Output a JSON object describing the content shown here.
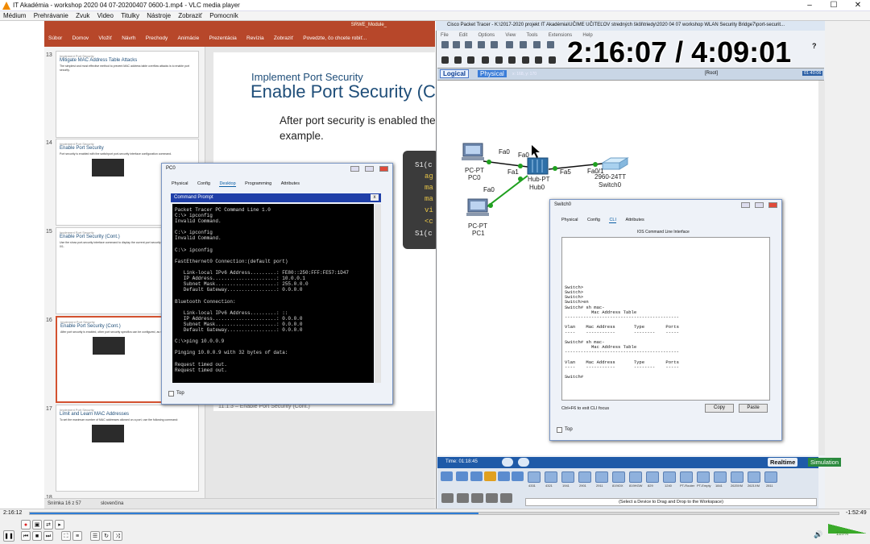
{
  "vlc": {
    "title": "IT Akadémia - workshop 2020 04 07-20200407 0600-1.mp4 - VLC media player",
    "menu": [
      "Médium",
      "Prehrávanie",
      "Zvuk",
      "Video",
      "Titulky",
      "Nástroje",
      "Zobraziť",
      "Pomocník"
    ],
    "elapsed": "2:16:12",
    "remaining": "-1:52:49",
    "volume": "120%",
    "progress_fraction": 0.555
  },
  "ppt": {
    "titlebar": "SRWE_Module_",
    "ribbon": [
      "Súbor",
      "Domov",
      "Vložiť",
      "Návrh",
      "Prechody",
      "Animácie",
      "Prezentácia",
      "Revízia",
      "Zobraziť",
      "Povedzte, čo chcete robiť..."
    ],
    "thumbs": [
      {
        "num": "13",
        "small": "Implement Port Security",
        "heading": "Mitigate MAC Address Table Attacks",
        "body": "The simplest and most effective method to prevent MAC address table overflow attacks is to enable port security."
      },
      {
        "num": "14",
        "small": "Implement Port Security",
        "heading": "Enable Port Security",
        "body": "Port security is enabled with the switchport port-security interface configuration command."
      },
      {
        "num": "15",
        "small": "Implement Port Security",
        "heading": "Enable Port Security (Cont.)",
        "body": "Use the show port-security interface command to display the current port security settings for FastEthernet 0/1."
      },
      {
        "num": "16",
        "small": "Implement Port Security",
        "heading": "Enable Port Security (Cont.)",
        "body": "After port security is enabled, other port security specifics can be configured, as shown in the example."
      },
      {
        "num": "17",
        "small": "Implement Port Security",
        "heading": "Limit and Learn MAC Addresses",
        "body": "To set the maximum number of MAC addresses allowed on a port, use the following command:"
      }
    ],
    "last_thumb_num": "18",
    "slide_subtitle": "Implement Port Security",
    "slide_title": "Enable Port Security (C",
    "slide_body": "After port security is enabled the example.",
    "code_lines": [
      "S1(c",
      "ag",
      "ma",
      "ma",
      "vi",
      "<c",
      "S1(c"
    ],
    "caption": "11.1.3 – Enable Port Security (Cont.)",
    "status": "Snímka 16 z 57",
    "status_lang": "slovenčina"
  },
  "pc0": {
    "title": "PC0",
    "tabs": [
      "Physical",
      "Config",
      "Desktop",
      "Programming",
      "Attributes"
    ],
    "cmd_title": "Command Prompt",
    "console": "Packet Tracer PC Command Line 1.0\nC:\\> ipconfig\nInvalid Command.\n\nC:\\> ipconfig\nInvalid Command.\n\nC:\\> ipconfig\n\nFastEthernet0 Connection:(default port)\n\n   Link-local IPv6 Address.........: FE80::250:FFF:FE57:1D47\n   IP Address......................: 10.0.0.1\n   Subnet Mask.....................: 255.0.0.0\n   Default Gateway.................: 0.0.0.0\n\nBluetooth Connection:\n\n   Link-local IPv6 Address.........: ::\n   IP Address......................: 0.0.0.0\n   Subnet Mask.....................: 0.0.0.0\n   Default Gateway.................: 0.0.0.0\n\nC:\\>ping 10.0.0.9\n\nPinging 10.0.0.9 with 32 bytes of data:\n\nRequest timed out.\nRequest timed out.",
    "top_label": "Top"
  },
  "pt": {
    "title": "Cisco Packet Tracer - K:\\2017-2020 projekt IT Akadémia\\UČIME UČITEĽOV stredných škôl\\triedy\\2020 04 07 workshop WLAN Security Bridge7\\port-securit...",
    "menu": [
      "File",
      "Edit",
      "Options",
      "View",
      "Tools",
      "Extensions",
      "Help"
    ],
    "logical": "Logical",
    "physical": "Physical",
    "coords": "x: 168, y: 170",
    "root": "[Root]",
    "clock": "01:40:06",
    "overlay_timer": "2:16:07 / 4:09:01",
    "devices": [
      {
        "name": "PC-PT",
        "sub": "PC0"
      },
      {
        "name": "PC-PT",
        "sub": "PC1"
      },
      {
        "name": "Hub-PT",
        "sub": "Hub0"
      },
      {
        "name": "2960-24TT",
        "sub": "Switch0"
      }
    ],
    "ports": {
      "pc0": "Fa0",
      "hub_top": "Fa0",
      "hub_left": "Fa1",
      "pc1": "Fa0",
      "hub_right": "Fa5",
      "sw": "Fa0/1"
    },
    "time": "Time: 01:18:45",
    "realtime": "Realtime",
    "simulation": "Simulation",
    "device_models": [
      "4331",
      "4321",
      "1941",
      "2901",
      "2911",
      "819IOX",
      "819HGW",
      "829",
      "1240",
      "PT-Router",
      "PT-Empty",
      "1841",
      "2620XM",
      "2621XM",
      "2811"
    ],
    "drag_hint": "(Select a Device to Drag and Drop to the Workspace)"
  },
  "switch": {
    "title": "Switch0",
    "tabs": [
      "Physical",
      "Config",
      "CLI",
      "Attributes"
    ],
    "heading": "IOS Command Line Interface",
    "cli": "\n\n\n\n\n\n\n\n\nSwitch>\nSwitch>\nSwitch>\nSwitch>en\nSwitch# sh mac-\n          Mac Address Table\n-------------------------------------------\n\nVlan    Mac Address       Type        Ports\n----    -----------       --------    -----\n\nSwitch# sh mac-\n          Mac Address Table\n-------------------------------------------\n\nVlan    Mac Address       Type        Ports\n----    -----------       --------    -----\n\nSwitch#",
    "hint": "Ctrl+F6 to exit CLI focus",
    "copy": "Copy",
    "paste": "Paste",
    "top_label": "Top"
  }
}
